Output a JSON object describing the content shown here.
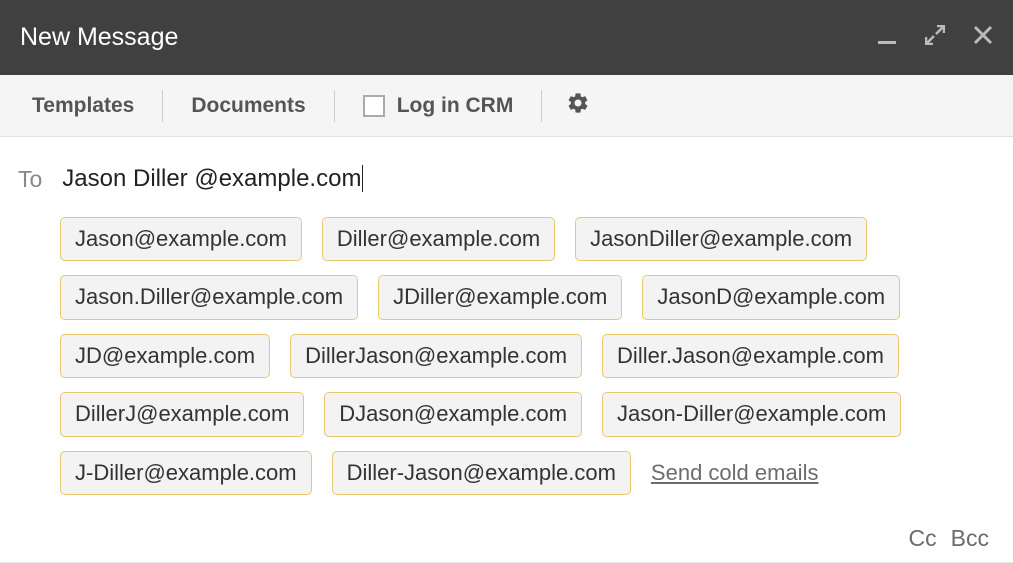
{
  "titlebar": {
    "title": "New Message"
  },
  "toolbar": {
    "templates": "Templates",
    "documents": "Documents",
    "log_in_crm": "Log in CRM"
  },
  "recipients": {
    "to_label": "To",
    "input_value": "Jason Diller @example.com",
    "suggestions": [
      "Jason@example.com",
      "Diller@example.com",
      "JasonDiller@example.com",
      "Jason.Diller@example.com",
      "JDiller@example.com",
      "JasonD@example.com",
      "JD@example.com",
      "DillerJason@example.com",
      "Diller.Jason@example.com",
      "DillerJ@example.com",
      "DJason@example.com",
      "Jason-Diller@example.com",
      "J-Diller@example.com",
      "Diller-Jason@example.com"
    ],
    "cold_email_link": "Send cold emails",
    "cc_label": "Cc",
    "bcc_label": "Bcc"
  }
}
